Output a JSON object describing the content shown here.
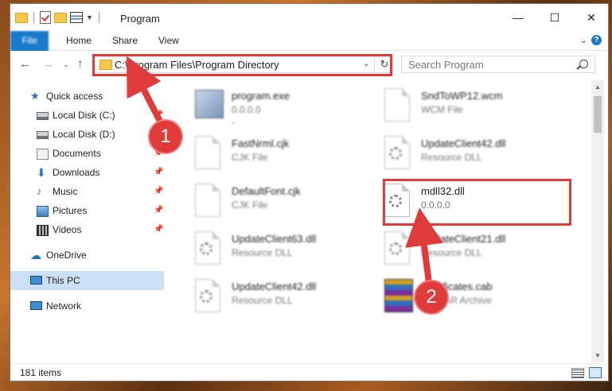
{
  "window": {
    "title": "Program",
    "minimize": "—",
    "maximize": "☐",
    "close": "✕"
  },
  "ribbon": {
    "tabs": [
      "File",
      "Home",
      "Share",
      "View"
    ]
  },
  "address": {
    "path": "C:\\Program Files\\Program Directory",
    "search_placeholder": "Search Program"
  },
  "sidebar": {
    "items": [
      {
        "label": "Quick access",
        "icon": "star-icon"
      },
      {
        "label": "Local Disk (C:)",
        "icon": "disk-icon"
      },
      {
        "label": "Local Disk (D:)",
        "icon": "disk-icon"
      },
      {
        "label": "Documents",
        "icon": "documents-icon"
      },
      {
        "label": "Downloads",
        "icon": "download-icon"
      },
      {
        "label": "Music",
        "icon": "music-icon"
      },
      {
        "label": "Pictures",
        "icon": "pictures-icon"
      },
      {
        "label": "Videos",
        "icon": "videos-icon"
      },
      {
        "label": "OneDrive",
        "icon": "cloud-icon"
      },
      {
        "label": "This PC",
        "icon": "computer-icon"
      },
      {
        "label": "Network",
        "icon": "network-icon"
      }
    ]
  },
  "files": [
    {
      "name": "program.exe",
      "sub": "0.0.0.0",
      "sub2": "-"
    },
    {
      "name": "SndToWP12.wcm",
      "sub": "WCM File"
    },
    {
      "name": "FastNrml.cjk",
      "sub": "CJK File"
    },
    {
      "name": "UpdateClient42.dll",
      "sub": "Resource DLL"
    },
    {
      "name": "DefaultFont.cjk",
      "sub": "CJK File"
    },
    {
      "name": "mdll32.dll",
      "sub": "0.0.0.0",
      "sub2": "-"
    },
    {
      "name": "UpdateClient63.dll",
      "sub": "Resource DLL"
    },
    {
      "name": "UpdateClient21.dll",
      "sub": "Resource DLL"
    },
    {
      "name": "UpdateClient42.dll",
      "sub": "Resource DLL"
    },
    {
      "name": "Certificates.cab",
      "sub": "WinRAR Archive"
    }
  ],
  "status": {
    "count": "181 items"
  },
  "annotations": {
    "badge1": "1",
    "badge2": "2",
    "color": "#e03a3a"
  }
}
